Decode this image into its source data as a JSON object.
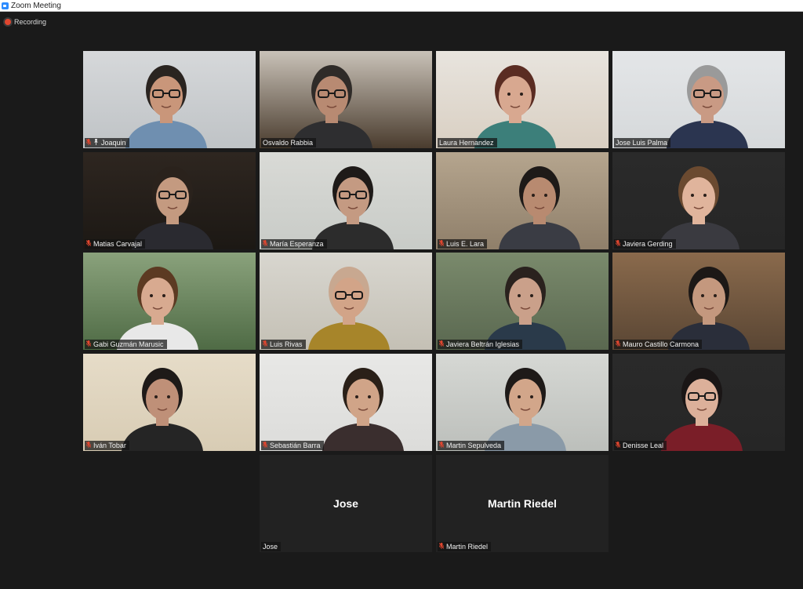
{
  "window": {
    "title": "Zoom Meeting"
  },
  "recording": {
    "label": "Recording"
  },
  "participants": [
    {
      "name": "Joaquin",
      "muted": true,
      "pinned": true,
      "video": true,
      "active": false
    },
    {
      "name": "Osvaldo Rabbia",
      "muted": false,
      "pinned": false,
      "video": true,
      "active": false
    },
    {
      "name": "Laura Hernandez",
      "muted": false,
      "pinned": false,
      "video": true,
      "active": true
    },
    {
      "name": "Jose Luis Palma",
      "muted": false,
      "pinned": false,
      "video": true,
      "active": false
    },
    {
      "name": "Matias Carvajal",
      "muted": true,
      "pinned": false,
      "video": true,
      "active": false
    },
    {
      "name": "María Esperanza",
      "muted": true,
      "pinned": false,
      "video": true,
      "active": false
    },
    {
      "name": "Luis E. Lara",
      "muted": true,
      "pinned": false,
      "video": true,
      "active": false
    },
    {
      "name": "Javiera Gerding",
      "muted": true,
      "pinned": false,
      "video": true,
      "active": false
    },
    {
      "name": "Gabi Guzmán Marusic",
      "muted": true,
      "pinned": false,
      "video": true,
      "active": false
    },
    {
      "name": "Luis Rivas",
      "muted": true,
      "pinned": false,
      "video": true,
      "active": false
    },
    {
      "name": "Javiera Beltrán Iglesias",
      "muted": true,
      "pinned": false,
      "video": true,
      "active": false
    },
    {
      "name": "Mauro Castillo Carmona",
      "muted": true,
      "pinned": false,
      "video": true,
      "active": false
    },
    {
      "name": "Iván Tobar",
      "muted": true,
      "pinned": false,
      "video": true,
      "active": false
    },
    {
      "name": "Sebastián Barra",
      "muted": true,
      "pinned": false,
      "video": true,
      "active": false
    },
    {
      "name": "Martin Sepulveda",
      "muted": true,
      "pinned": false,
      "video": true,
      "active": false
    },
    {
      "name": "Denisse Leal",
      "muted": true,
      "pinned": false,
      "video": true,
      "active": false
    },
    {
      "name": "Jose",
      "muted": false,
      "pinned": false,
      "video": false,
      "active": false
    },
    {
      "name": "Martin Riedel",
      "muted": true,
      "pinned": false,
      "video": false,
      "active": false
    }
  ],
  "colors": {
    "active_speaker_border": "#9bd33a",
    "muted_icon": "#e0462f",
    "background": "#1a1a1a"
  }
}
